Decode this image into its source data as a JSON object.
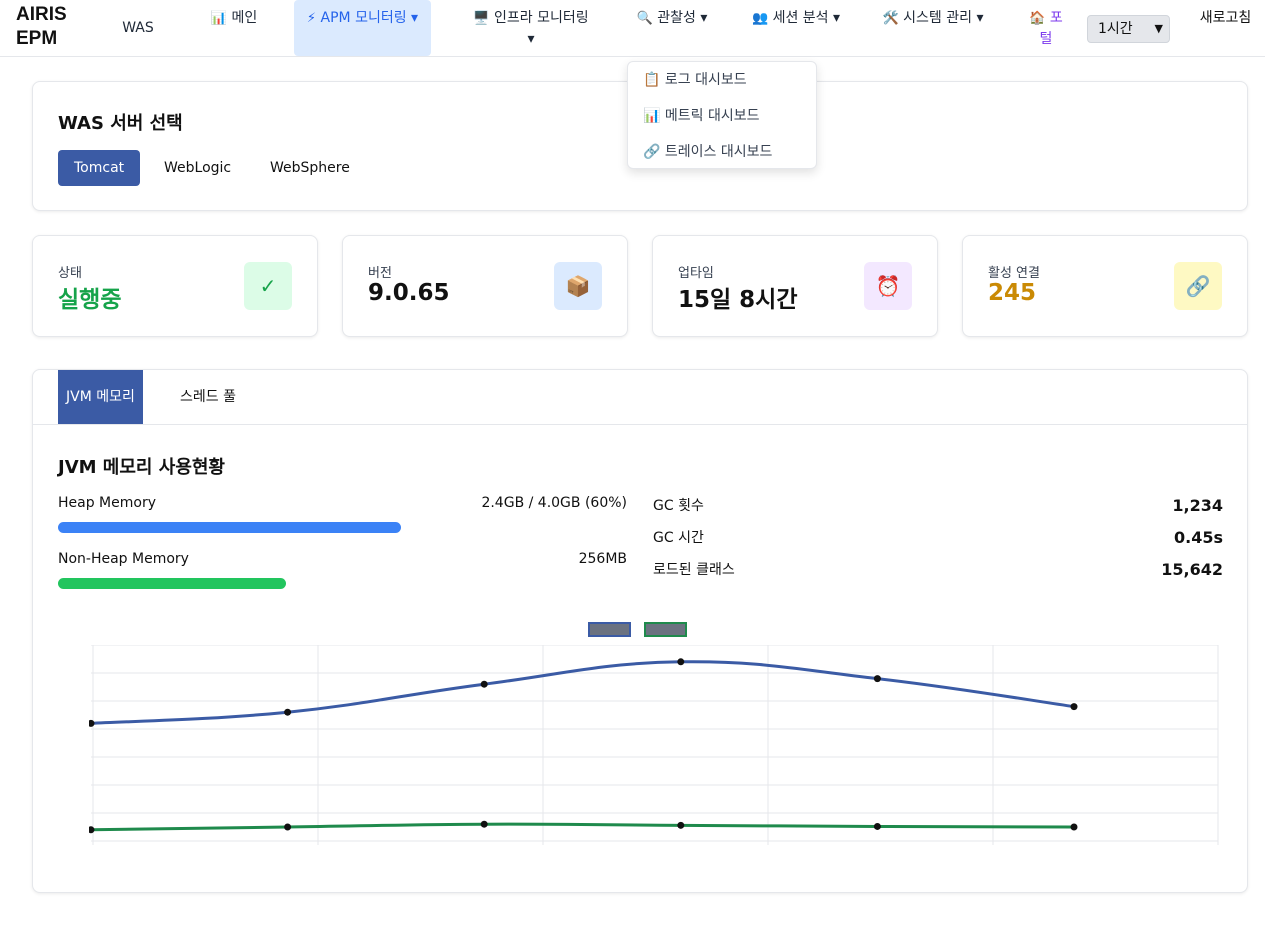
{
  "header": {
    "brand": "AIRIS EPM",
    "nav": [
      {
        "icon": "",
        "label": "WAS"
      },
      {
        "icon": "📊",
        "label": "메인"
      },
      {
        "icon": "⚡",
        "label": "APM 모니터링 ▾"
      },
      {
        "icon": "🖥️",
        "label": "인프라 모니터링 ▾"
      },
      {
        "icon": "🔍",
        "label": "관찰성 ▾"
      },
      {
        "icon": "👥",
        "label": "세션 분석 ▾"
      },
      {
        "icon": "🛠️",
        "label": "시스템 관리 ▾"
      },
      {
        "icon": "🏠",
        "label": "포털"
      }
    ],
    "time_range": "1시간",
    "refresh_label": "새로고침"
  },
  "dropdown": {
    "items": [
      {
        "icon": "📋",
        "label": "로그 대시보드"
      },
      {
        "icon": "📊",
        "label": "메트릭 대시보드"
      },
      {
        "icon": "🔗",
        "label": "트레이스 대시보드"
      }
    ]
  },
  "server_select": {
    "title": "WAS 서버 선택",
    "servers": [
      "Tomcat",
      "WebLogic",
      "WebSphere"
    ],
    "selected": "Tomcat"
  },
  "stats": [
    {
      "label": "상태",
      "value": "실행중",
      "icon": "✓",
      "value_color": "#16a34a",
      "icon_bg": "#dcfce7",
      "icon_color": "#16a34a"
    },
    {
      "label": "버전",
      "value": "9.0.65",
      "icon": "📦",
      "value_color": "#111111",
      "icon_bg": "#dbeafe",
      "icon_color": "#111111"
    },
    {
      "label": "업타임",
      "value": "15일 8시간",
      "icon": "⏰",
      "value_color": "#111111",
      "icon_bg": "#f3e8ff",
      "icon_color": "#111111"
    },
    {
      "label": "활성 연결",
      "value": "245",
      "icon": "🔗",
      "value_color": "#ca8a04",
      "icon_bg": "#fef9c3",
      "icon_color": "#111111"
    }
  ],
  "tabs": [
    "JVM 메모리",
    "스레드 풀"
  ],
  "jvm": {
    "title": "JVM 메모리 사용현황",
    "heap": {
      "label": "Heap Memory",
      "value": "2.4GB / 4.0GB (60%)",
      "fill": 0.6,
      "color": "#3b82f6"
    },
    "nonheap": {
      "label": "Non-Heap Memory",
      "value": "256MB",
      "fill": 0.4,
      "color": "#22c55e"
    },
    "gc": [
      {
        "label": "GC 횟수",
        "value": "1,234"
      },
      {
        "label": "GC 시간",
        "value": "0.45s"
      },
      {
        "label": "로드된 클래스",
        "value": "15,642"
      }
    ]
  },
  "chart_data": {
    "type": "line",
    "title": "",
    "xlabel": "",
    "ylabel": "",
    "categories": [
      "",
      "",
      "",
      "",
      "",
      ""
    ],
    "series": [
      {
        "values": [
          2.1,
          2.3,
          2.8,
          3.2,
          2.9,
          2.4
        ],
        "color": "#3b5ba5"
      },
      {
        "values": [
          0.2,
          0.25,
          0.3,
          0.28,
          0.26,
          0.25
        ],
        "color": "#1f8a4c"
      }
    ],
    "ylim": [
      0,
      3.5
    ],
    "grid": true,
    "legend": "top-center"
  }
}
